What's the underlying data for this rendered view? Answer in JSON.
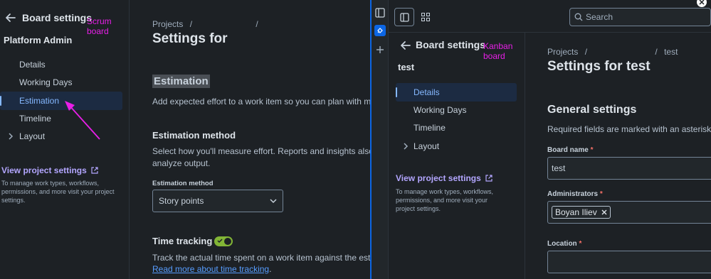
{
  "scrum": {
    "annotation": "Scrum board",
    "sidebar": {
      "title": "Board settings",
      "board_name": "Platform Admin",
      "items": [
        {
          "label": "Details"
        },
        {
          "label": "Working Days"
        },
        {
          "label": "Estimation"
        },
        {
          "label": "Timeline"
        },
        {
          "label": "Layout"
        }
      ],
      "project_link": "View project settings",
      "help_text_lines": [
        "To manage work types, workflows,",
        "permissions, and more visit your project",
        "settings."
      ]
    },
    "main": {
      "breadcrumb_root": "Projects",
      "breadcrumb_sep": "/",
      "breadcrumb_sep2": "/",
      "page_title": "Settings for",
      "section_title": "Estimation",
      "section_desc": "Add expected effort to a work item so you can plan with more",
      "method_title": "Estimation method",
      "method_desc_lines": [
        "Select how you'll measure effort. Reports and insights also use",
        "analyze output."
      ],
      "method_label": "Estimation method",
      "method_value": "Story points",
      "tracking_title": "Time tracking",
      "tracking_enabled": true,
      "tracking_desc": "Track the actual time spent on a work item against the estimate",
      "tracking_link": "Read more about time tracking",
      "tracking_link_suffix": "."
    }
  },
  "kanban": {
    "annotation": "Kanban board",
    "search_placeholder": "Search",
    "sidebar": {
      "title": "Board settings",
      "board_name": "test",
      "items": [
        {
          "label": "Details"
        },
        {
          "label": "Working Days"
        },
        {
          "label": "Timeline"
        },
        {
          "label": "Layout"
        }
      ],
      "project_link": "View project settings",
      "help_text_lines": [
        "To manage work types, workflows,",
        "permissions, and more visit your",
        "project settings."
      ]
    },
    "main": {
      "breadcrumb_root": "Projects",
      "breadcrumb_sep": "/",
      "breadcrumb_sep2": "/",
      "breadcrumb_last": "test",
      "page_title": "Settings for test",
      "section_title": "General settings",
      "section_desc": "Required fields are marked with an asterisk",
      "board_name_label": "Board name",
      "board_name_value": "test",
      "admins_label": "Administrators",
      "admin_chip": "Boyan Iliev",
      "location_label": "Location",
      "required_marker": "*"
    }
  },
  "colors": {
    "annotation": "#e81fe8",
    "active_bg": "#1c2b42",
    "active_text": "#85b8ff",
    "link": "#b3a6ff",
    "toggle_on": "#82b536"
  }
}
